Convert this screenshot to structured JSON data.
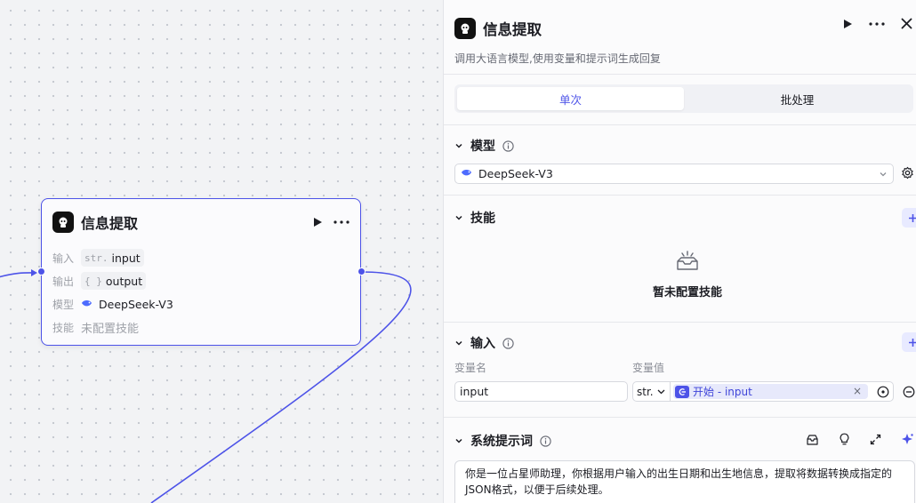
{
  "node": {
    "title": "信息提取",
    "rows": {
      "input_label": "输入",
      "input_type": "str.",
      "input_value": "input",
      "output_label": "输出",
      "output_type": "{ }",
      "output_value": "output",
      "model_label": "模型",
      "model_value": "DeepSeek-V3",
      "skill_label": "技能",
      "skill_value": "未配置技能"
    }
  },
  "panel": {
    "title": "信息提取",
    "description": "调用大语言模型,使用变量和提示词生成回复",
    "tabs": [
      {
        "label": "单次",
        "active": true
      },
      {
        "label": "批处理",
        "active": false
      }
    ],
    "model_section": {
      "title": "模型",
      "selected": "DeepSeek-V3"
    },
    "skills_section": {
      "title": "技能",
      "empty_text": "暂未配置技能"
    },
    "input_section": {
      "title": "输入",
      "col_name_label": "变量名",
      "col_value_label": "变量值",
      "row": {
        "name": "input",
        "type": "str.",
        "ref_text": "开始 - input"
      }
    },
    "prompt_section": {
      "title": "系统提示词",
      "text": "你是一位占星师助理，你根据用户输入的出生日期和出生地信息，提取将数据转换成指定的JSON格式，以便于后续处理。"
    }
  },
  "colors": {
    "accent": "#4d53e8",
    "accent_soft": "#e7e9fb",
    "border": "#d7d9df",
    "muted_text": "#9ea1a8"
  },
  "icons": {
    "node_icon": "llm-robot-icon",
    "run": "play-icon",
    "more": "more-dots-icon",
    "close": "close-icon",
    "model": "deepseek-whale-icon",
    "settings": "gear-icon",
    "add": "plus-icon",
    "empty": "empty-tray-icon",
    "remove": "minus-circle-icon",
    "variable_ref": "variable-ref-icon"
  }
}
